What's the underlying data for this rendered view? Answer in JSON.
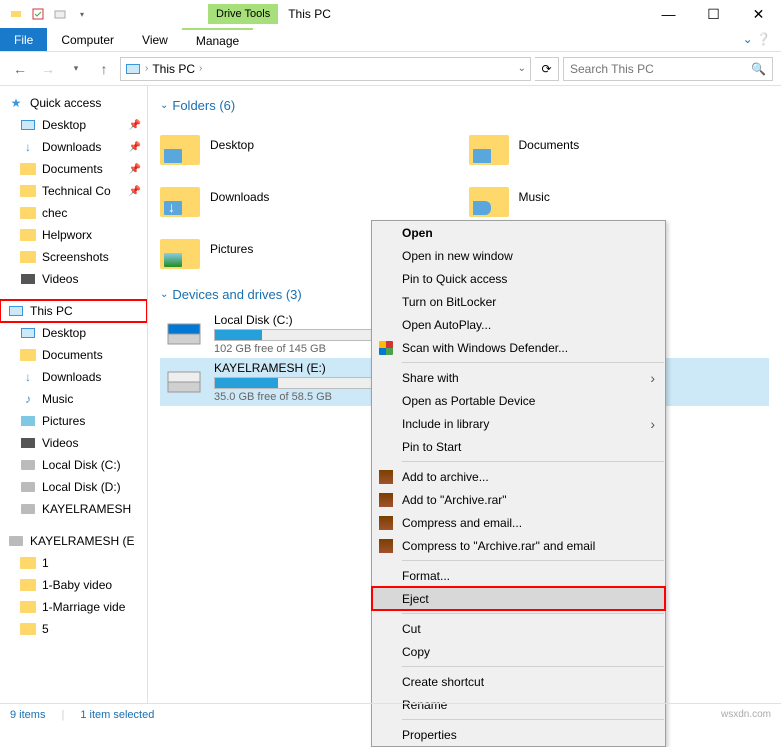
{
  "title": "This PC",
  "ribbon": {
    "drive_tools": "Drive Tools",
    "file": "File",
    "computer": "Computer",
    "view": "View",
    "manage": "Manage"
  },
  "breadcrumb": {
    "root": "This PC"
  },
  "search": {
    "placeholder": "Search This PC"
  },
  "sidebar": {
    "quick_access": "Quick access",
    "items_qa": [
      {
        "label": "Desktop",
        "pinned": true,
        "icon": "monitor"
      },
      {
        "label": "Downloads",
        "pinned": true,
        "icon": "down"
      },
      {
        "label": "Documents",
        "pinned": true,
        "icon": "folder"
      },
      {
        "label": "Technical Co",
        "pinned": true,
        "icon": "folder"
      },
      {
        "label": "chec",
        "pinned": false,
        "icon": "folder"
      },
      {
        "label": "Helpworx",
        "pinned": false,
        "icon": "folder"
      },
      {
        "label": "Screenshots",
        "pinned": false,
        "icon": "folder"
      },
      {
        "label": "Videos",
        "pinned": false,
        "icon": "vid"
      }
    ],
    "this_pc": "This PC",
    "items_pc": [
      {
        "label": "Desktop",
        "icon": "monitor"
      },
      {
        "label": "Documents",
        "icon": "folder"
      },
      {
        "label": "Downloads",
        "icon": "down"
      },
      {
        "label": "Music",
        "icon": "music"
      },
      {
        "label": "Pictures",
        "icon": "pic"
      },
      {
        "label": "Videos",
        "icon": "vid"
      },
      {
        "label": "Local Disk (C:)",
        "icon": "disk"
      },
      {
        "label": "Local Disk (D:)",
        "icon": "disk"
      },
      {
        "label": "KAYELRAMESH",
        "icon": "disk"
      }
    ],
    "kayel": "KAYELRAMESH (E",
    "items_usb": [
      {
        "label": "1",
        "icon": "folder"
      },
      {
        "label": "1-Baby video",
        "icon": "folder"
      },
      {
        "label": "1-Marriage vide",
        "icon": "folder"
      },
      {
        "label": "5",
        "icon": "folder"
      }
    ]
  },
  "sections": {
    "folders_hdr": "Folders (6)",
    "folders": [
      {
        "label": "Desktop"
      },
      {
        "label": "Documents"
      },
      {
        "label": "Downloads"
      },
      {
        "label": "Music"
      },
      {
        "label": "Pictures"
      }
    ],
    "drives_hdr": "Devices and drives (3)",
    "drives": [
      {
        "name": "Local Disk (C:)",
        "free": "102 GB free of 145 GB",
        "fill": 30
      },
      {
        "name": "KAYELRAMESH (E:)",
        "free": "35.0 GB free of 58.5 GB",
        "fill": 40
      }
    ]
  },
  "context_menu": [
    {
      "label": "Open",
      "bold": true
    },
    {
      "label": "Open in new window"
    },
    {
      "label": "Pin to Quick access"
    },
    {
      "label": "Turn on BitLocker"
    },
    {
      "label": "Open AutoPlay..."
    },
    {
      "label": "Scan with Windows Defender...",
      "icon": "shield"
    },
    {
      "sep": true
    },
    {
      "label": "Share with",
      "sub": true
    },
    {
      "label": "Open as Portable Device"
    },
    {
      "label": "Include in library",
      "sub": true
    },
    {
      "label": "Pin to Start"
    },
    {
      "sep": true
    },
    {
      "label": "Add to archive...",
      "icon": "rar"
    },
    {
      "label": "Add to \"Archive.rar\"",
      "icon": "rar"
    },
    {
      "label": "Compress and email...",
      "icon": "rar"
    },
    {
      "label": "Compress to \"Archive.rar\" and email",
      "icon": "rar"
    },
    {
      "sep": true
    },
    {
      "label": "Format..."
    },
    {
      "label": "Eject",
      "highlight": true
    },
    {
      "sep": true
    },
    {
      "label": "Cut"
    },
    {
      "label": "Copy"
    },
    {
      "sep": true
    },
    {
      "label": "Create shortcut"
    },
    {
      "label": "Rename"
    },
    {
      "sep": true
    },
    {
      "label": "Properties"
    }
  ],
  "status": {
    "items": "9 items",
    "selected": "1 item selected"
  },
  "watermark": "wsxdn.com"
}
